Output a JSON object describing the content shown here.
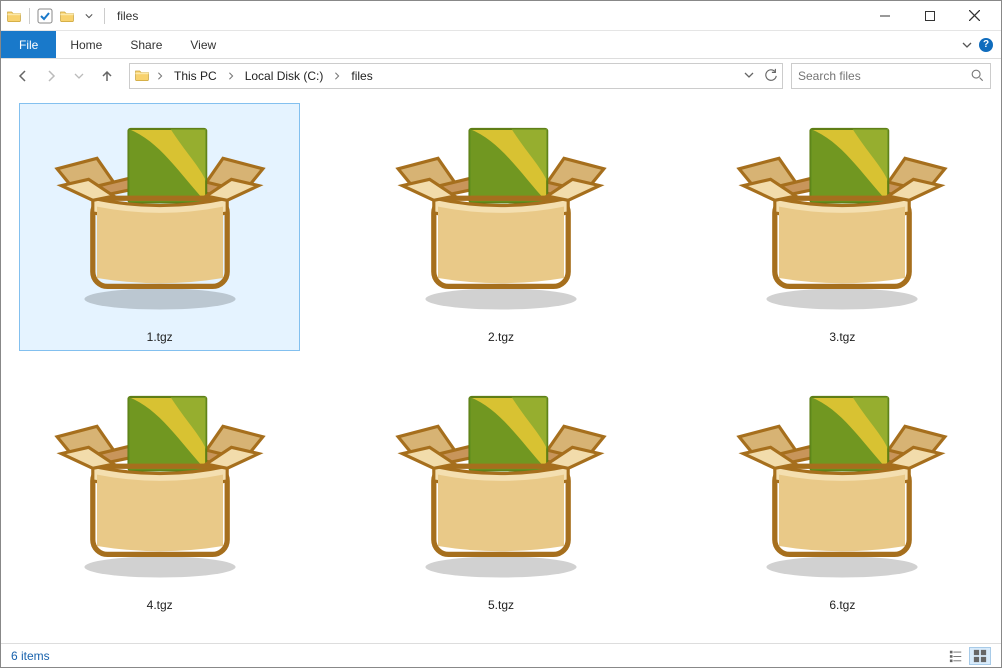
{
  "title": "files",
  "ribbon": {
    "file": "File",
    "home": "Home",
    "share": "Share",
    "view": "View"
  },
  "breadcrumb": {
    "root_icon": "folder-icon",
    "segments": [
      "This PC",
      "Local Disk (C:)",
      "files"
    ]
  },
  "search": {
    "placeholder": "Search files"
  },
  "files": [
    {
      "name": "1.tgz",
      "selected": true
    },
    {
      "name": "2.tgz",
      "selected": false
    },
    {
      "name": "3.tgz",
      "selected": false
    },
    {
      "name": "4.tgz",
      "selected": false
    },
    {
      "name": "5.tgz",
      "selected": false
    },
    {
      "name": "6.tgz",
      "selected": false
    }
  ],
  "status": {
    "count_text": "6 items"
  }
}
